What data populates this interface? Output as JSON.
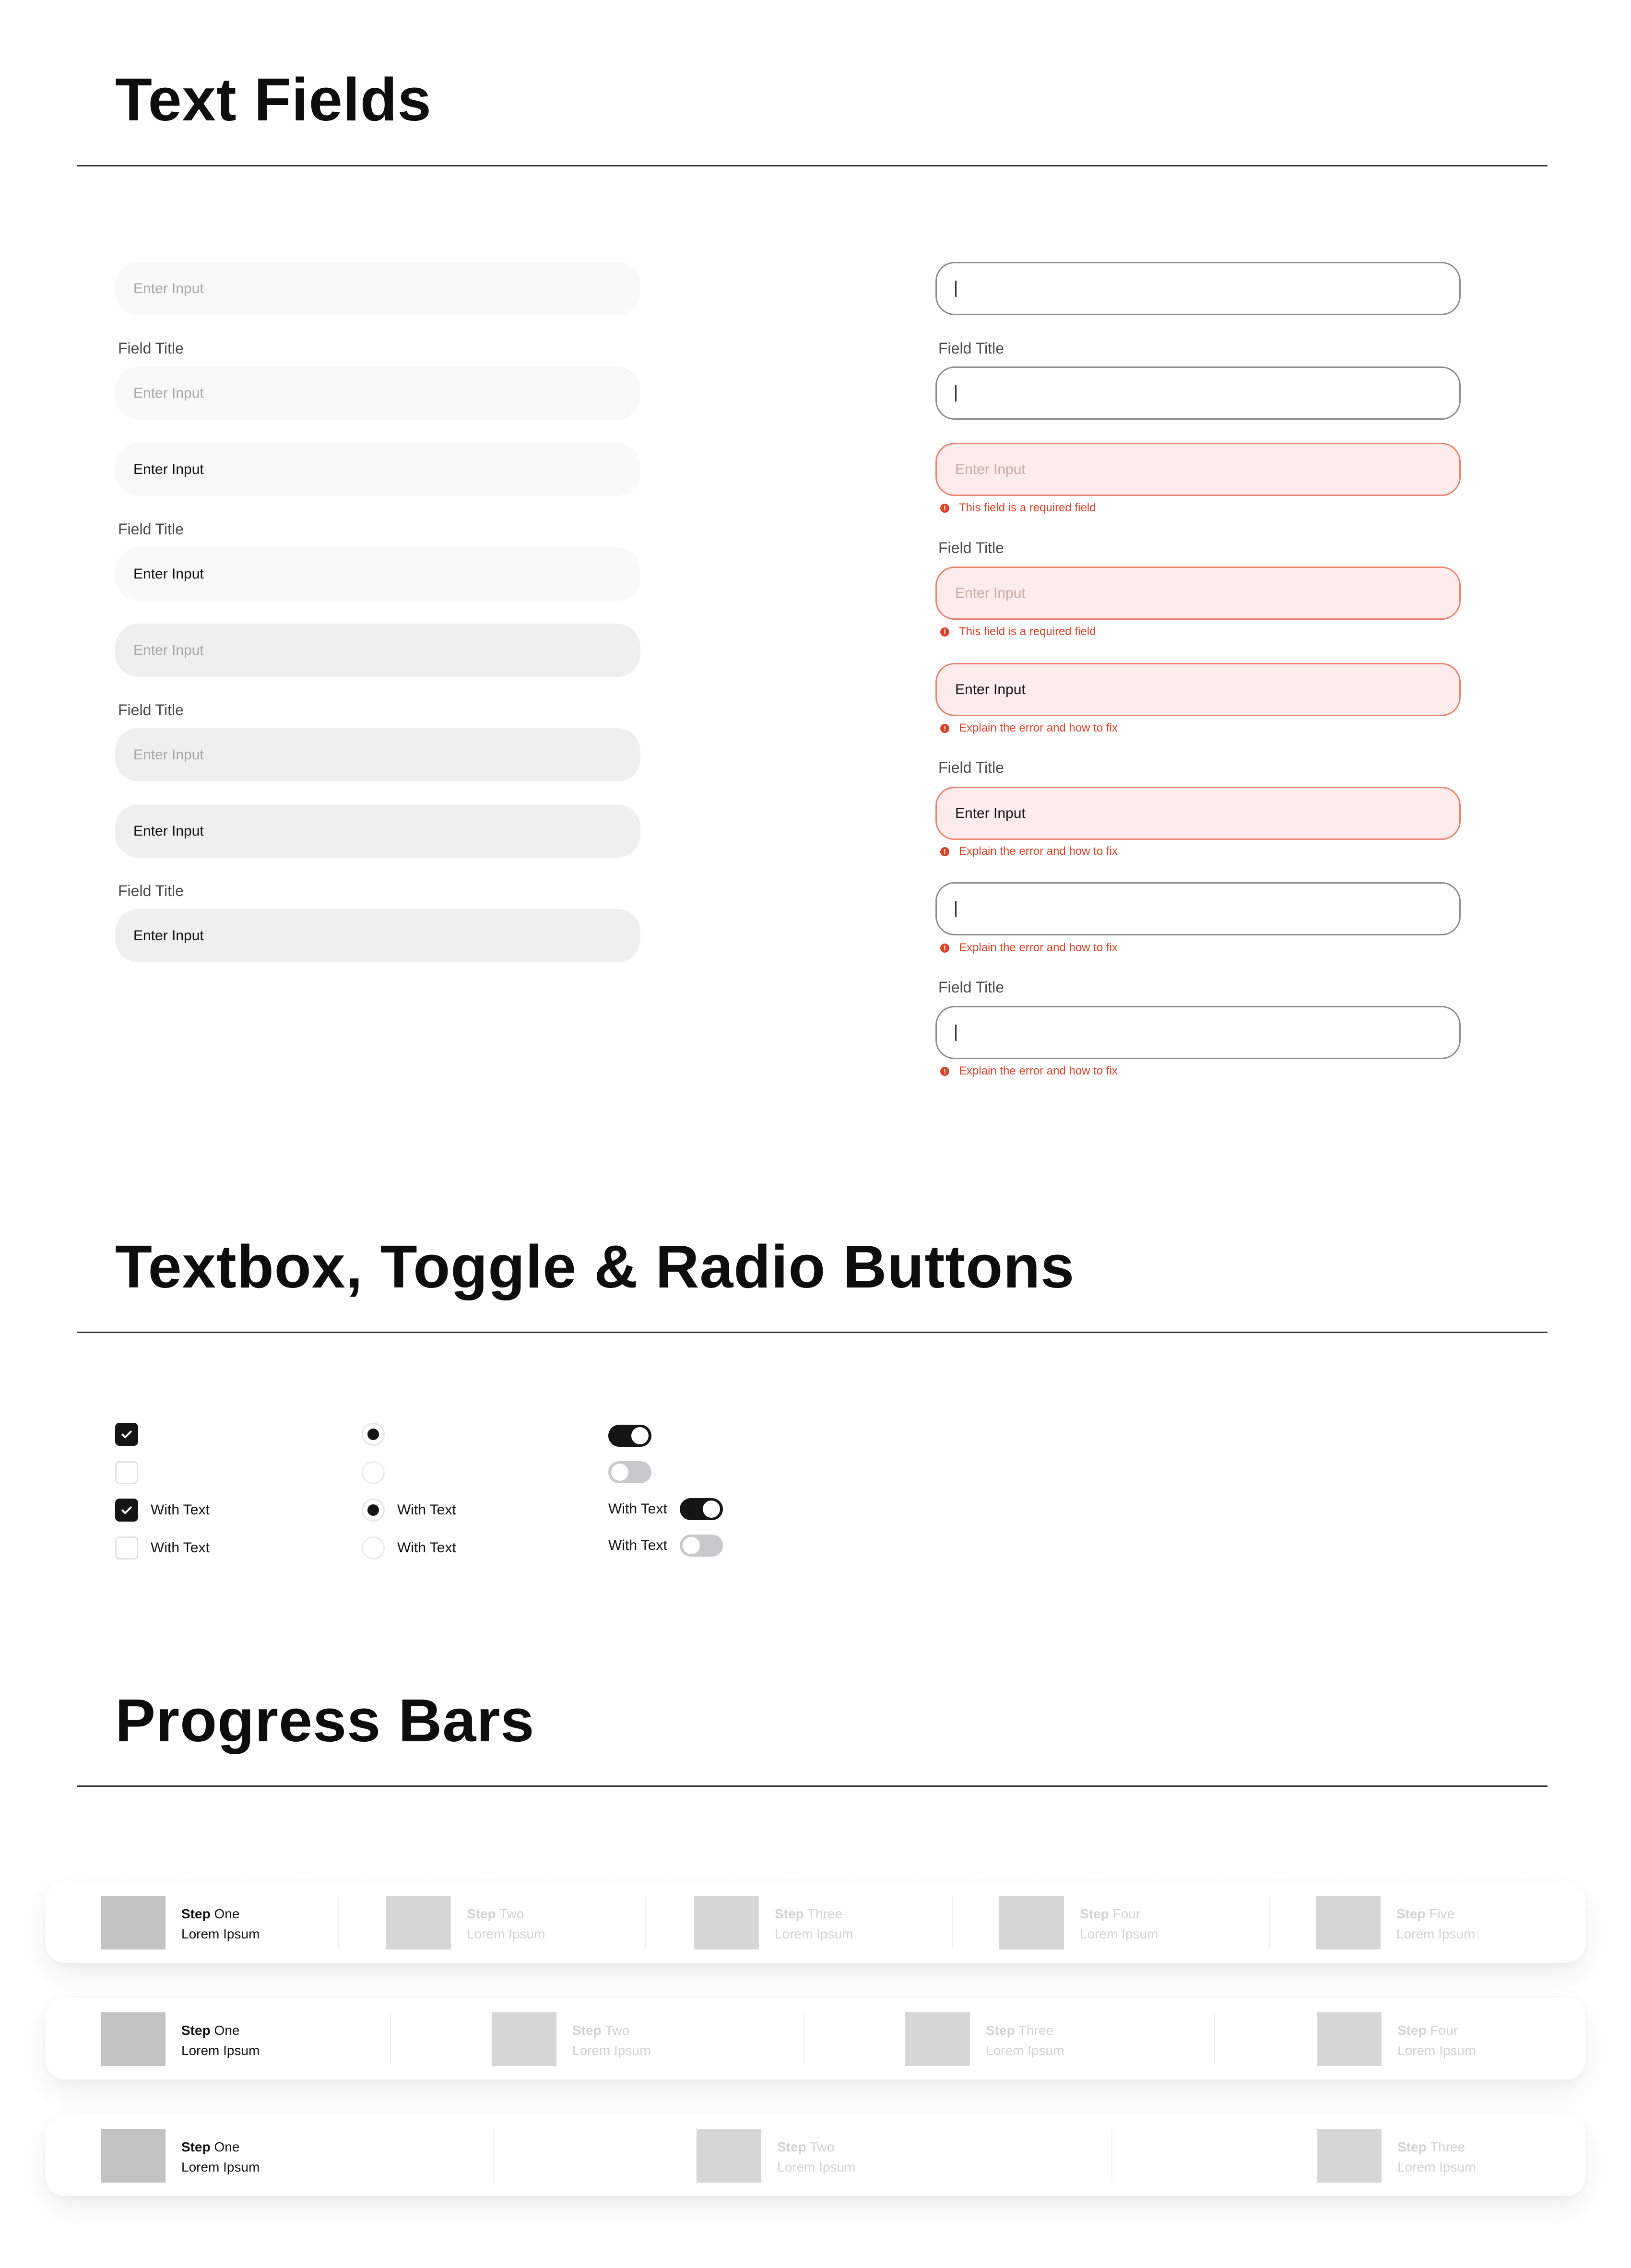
{
  "sections": {
    "text_fields": "Text Fields",
    "controls": "Textbox, Toggle & Radio Buttons",
    "progress": "Progress Bars"
  },
  "fields": {
    "placeholder": "Enter Input",
    "value": "Enter Input",
    "title": "Field Title",
    "cursor_text": "|",
    "error_required": "This field is a required field",
    "error_explain": "Explain the error and how to fix"
  },
  "controls": {
    "with_text": "With Text"
  },
  "progress": {
    "lorem": "Lorem Ipsum",
    "step_word": "Step",
    "bars": [
      [
        "One",
        "Two",
        "Three",
        "Four",
        "Five"
      ],
      [
        "One",
        "Two",
        "Three",
        "Four"
      ],
      [
        "One",
        "Two",
        "Three"
      ]
    ]
  },
  "colors": {
    "error": "#d9432c",
    "dark": "#151515",
    "field_light": "#f8f8f8",
    "field_grey": "#efefef",
    "error_bg": "#fdeceb"
  }
}
